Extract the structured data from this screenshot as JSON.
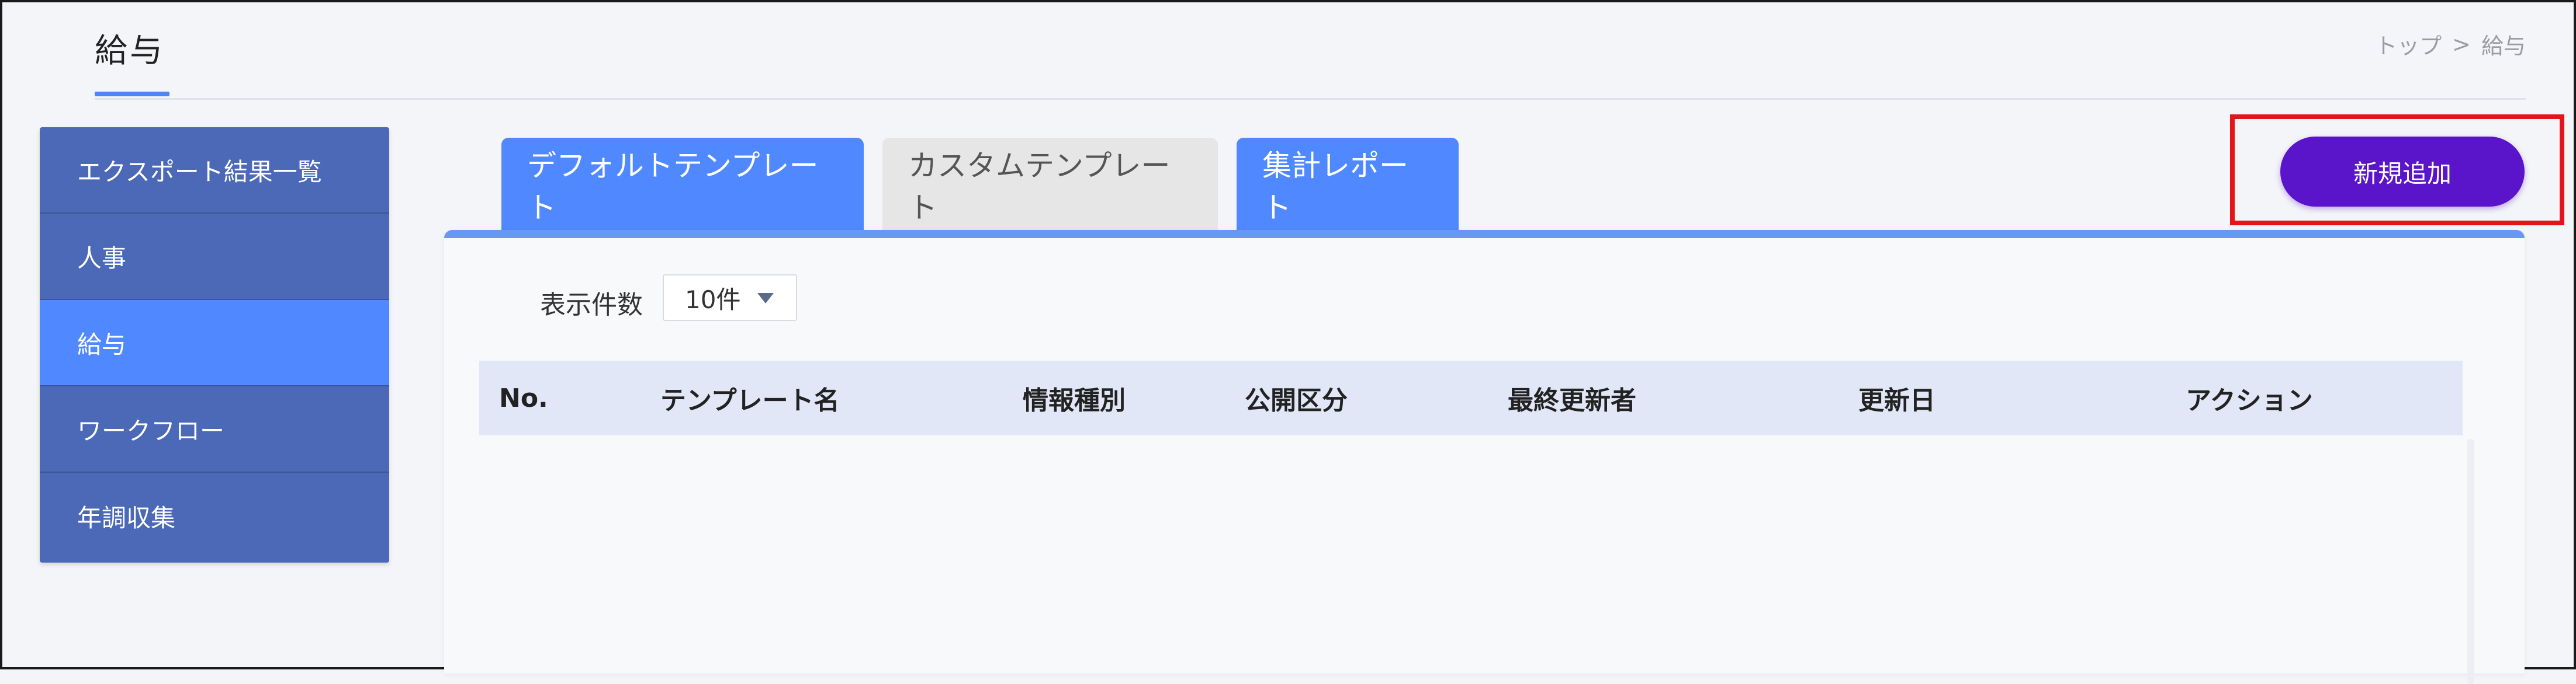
{
  "header": {
    "title": "給与",
    "breadcrumb": [
      "トップ",
      ">",
      "給与"
    ]
  },
  "sidebar": {
    "items": [
      {
        "label": "エクスポート結果一覧",
        "active": false
      },
      {
        "label": "人事",
        "active": false
      },
      {
        "label": "給与",
        "active": true
      },
      {
        "label": "ワークフロー",
        "active": false
      },
      {
        "label": "年調収集",
        "active": false
      }
    ]
  },
  "tabs": [
    {
      "label": "デフォルトテンプレート"
    },
    {
      "label": "カスタムテンプレート"
    },
    {
      "label": "集計レポート"
    }
  ],
  "toolbar": {
    "new_label": "新規追加"
  },
  "filters": {
    "page_size_label": "表示件数",
    "page_size_value": "10件"
  },
  "table": {
    "columns": [
      "No.",
      "テンプレート名",
      "情報種別",
      "公開区分",
      "最終更新者",
      "更新日",
      "アクション"
    ]
  },
  "colors": {
    "primary_blue": "#5089ff",
    "sidebar_blue": "#4b69b6",
    "button_purple": "#5a14c9",
    "highlight_red": "#e3151a"
  }
}
